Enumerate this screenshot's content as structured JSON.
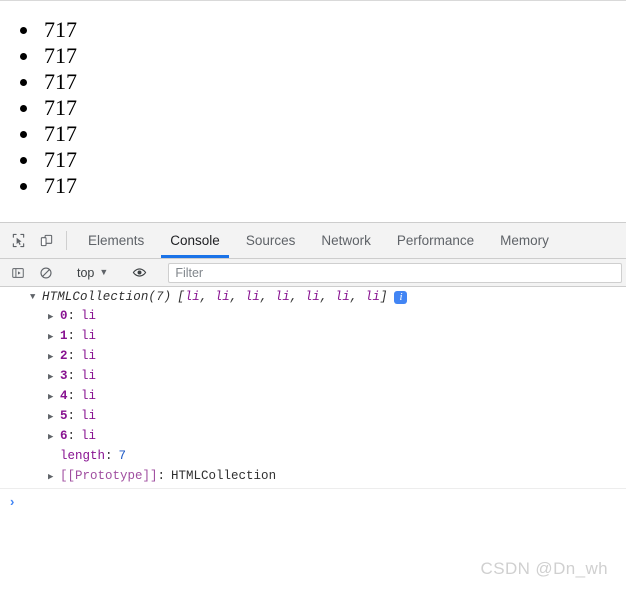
{
  "page": {
    "list_items": [
      "717",
      "717",
      "717",
      "717",
      "717",
      "717",
      "717"
    ]
  },
  "devtools": {
    "toolbar": {
      "inspect_icon": "inspect-element-icon",
      "device_icon": "device-toolbar-icon"
    },
    "tabs": [
      {
        "label": "Elements",
        "active": false
      },
      {
        "label": "Console",
        "active": true
      },
      {
        "label": "Sources",
        "active": false
      },
      {
        "label": "Network",
        "active": false
      },
      {
        "label": "Performance",
        "active": false
      },
      {
        "label": "Memory",
        "active": false
      }
    ],
    "console_toolbar": {
      "sidebar_icon": "console-sidebar-icon",
      "clear_icon": "clear-console-icon",
      "context": "top",
      "context_caret": "▼",
      "eye_icon": "live-expression-eye-icon",
      "filter_placeholder": "Filter",
      "filter_value": ""
    },
    "console_output": {
      "object_name": "HTMLCollection(7)",
      "preview_open": "[",
      "preview_items": [
        "li",
        "li",
        "li",
        "li",
        "li",
        "li",
        "li"
      ],
      "preview_close": "]",
      "info_badge": "i",
      "properties": [
        {
          "key": "0",
          "value": "li",
          "expandable": true
        },
        {
          "key": "1",
          "value": "li",
          "expandable": true
        },
        {
          "key": "2",
          "value": "li",
          "expandable": true
        },
        {
          "key": "3",
          "value": "li",
          "expandable": true
        },
        {
          "key": "4",
          "value": "li",
          "expandable": true
        },
        {
          "key": "5",
          "value": "li",
          "expandable": true
        },
        {
          "key": "6",
          "value": "li",
          "expandable": true
        }
      ],
      "length_key": "length",
      "length_value": "7",
      "prototype_key": "[[Prototype]]",
      "prototype_value": "HTMLCollection"
    },
    "prompt": {
      "caret": "›",
      "value": ""
    }
  },
  "watermark": "CSDN @Dn_wh",
  "colors": {
    "accent_blue": "#1a73e8",
    "info_badge_blue": "#4285f4",
    "property_purple": "#881391",
    "number_blue": "#1a56c4",
    "toolbar_bg": "#f3f3f3"
  }
}
